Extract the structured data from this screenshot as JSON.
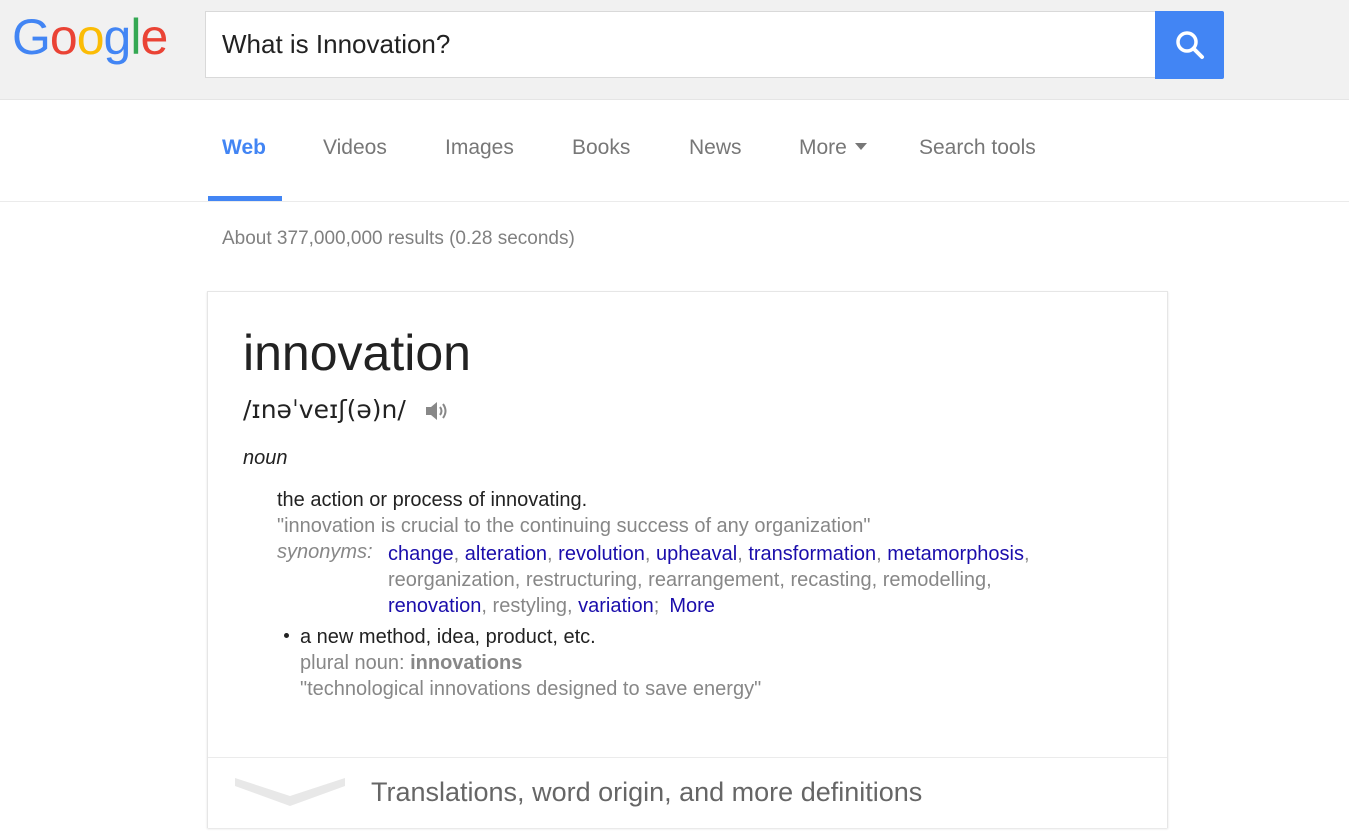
{
  "logo": {
    "letters": [
      "G",
      "o",
      "o",
      "g",
      "l",
      "e"
    ],
    "colors": [
      "#4285f4",
      "#ea4335",
      "#fbbc05",
      "#4285f4",
      "#34a853",
      "#ea4335"
    ]
  },
  "search": {
    "value": "What is Innovation?",
    "button_icon": "search-icon",
    "accent": "#4285f4"
  },
  "tabs": [
    {
      "label": "Web",
      "active": true
    },
    {
      "label": "Videos"
    },
    {
      "label": "Images"
    },
    {
      "label": "Books"
    },
    {
      "label": "News"
    },
    {
      "label": "More"
    },
    {
      "label": "Search tools"
    }
  ],
  "results": {
    "stats": "About 377,000,000 results (0.28 seconds)"
  },
  "definition": {
    "word": "innovation",
    "phonetic": "/ɪnəˈveɪʃ(ə)n/",
    "part_of_speech": "noun",
    "sense1": {
      "definition": "the action or process of innovating.",
      "example": "\"innovation is crucial to the continuing success of any organization\"",
      "synonyms_label": "synonyms:",
      "synonyms": [
        {
          "text": "change",
          "link": true
        },
        {
          "text": "alteration",
          "link": true
        },
        {
          "text": "revolution",
          "link": true
        },
        {
          "text": "upheaval",
          "link": true
        },
        {
          "text": "transformation",
          "link": true
        },
        {
          "text": "metamorphosis",
          "link": true
        },
        {
          "text": "reorganization",
          "link": false
        },
        {
          "text": "restructuring",
          "link": false
        },
        {
          "text": "rearrangement",
          "link": false
        },
        {
          "text": "recasting",
          "link": false
        },
        {
          "text": "remodelling",
          "link": false
        },
        {
          "text": "renovation",
          "link": true
        },
        {
          "text": "restyling",
          "link": false
        },
        {
          "text": "variation",
          "link": true
        }
      ],
      "more_label": "More"
    },
    "sense2": {
      "definition": "a new method, idea, product, etc.",
      "plural_label": "plural noun:",
      "plural": "innovations",
      "example": "\"technological innovations designed to save energy\""
    },
    "footer": "Translations, word origin, and more definitions"
  }
}
